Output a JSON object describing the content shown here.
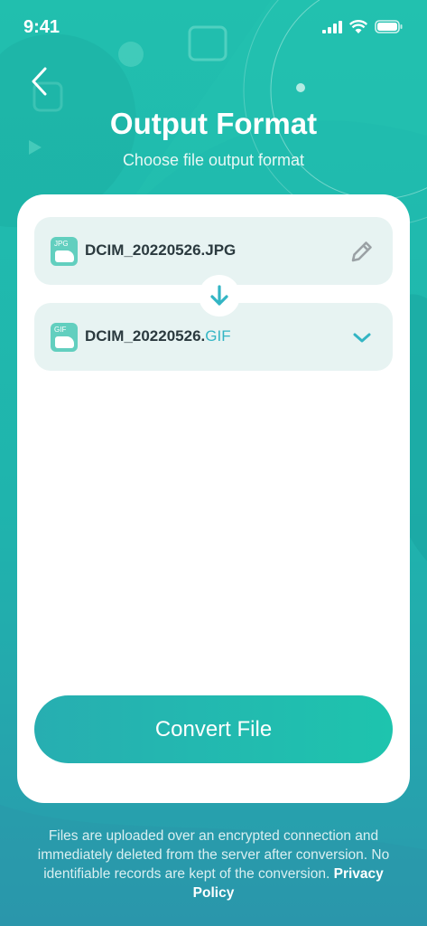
{
  "status_bar": {
    "time": "9:41"
  },
  "header": {
    "title": "Output Format",
    "subtitle": "Choose file output format"
  },
  "source_file": {
    "name": "DCIM_20220526.JPG",
    "icon_tag": "JPG"
  },
  "target_file": {
    "name_base": "DCIM_20220526.",
    "extension": "GIF",
    "icon_tag": "GIF"
  },
  "actions": {
    "convert_label": "Convert File"
  },
  "footer": {
    "notice": "Files are uploaded over an encrypted connection and immediately deleted from the server after conversion. No identifiable records are kept of the conversion.",
    "privacy_link": "Privacy Policy"
  },
  "icons": {
    "back": "chevron-left-icon",
    "edit": "pencil-icon",
    "arrow": "arrow-down-icon",
    "dropdown": "chevron-down-icon",
    "signal": "signal-icon",
    "wifi": "wifi-icon",
    "battery": "battery-icon"
  },
  "colors": {
    "accent": "#33b5c4",
    "brand_start": "#27aeb1",
    "brand_end": "#1ec4ae",
    "row_bg": "#e7f3f2"
  }
}
